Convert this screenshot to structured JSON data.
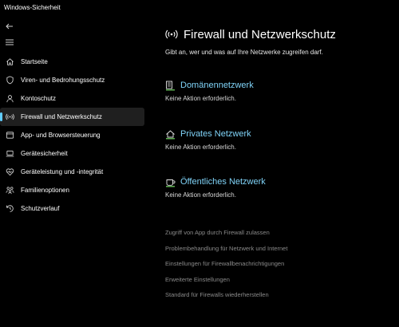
{
  "window": {
    "title": "Windows-Sicherheit"
  },
  "sidebar": {
    "items": [
      {
        "label": "Startseite",
        "icon": "home-icon"
      },
      {
        "label": "Viren- und Bedrohungsschutz",
        "icon": "shield-icon"
      },
      {
        "label": "Kontoschutz",
        "icon": "person-icon"
      },
      {
        "label": "Firewall und Netzwerkschutz",
        "icon": "antenna-icon",
        "active": true
      },
      {
        "label": "App- und Browsersteuerung",
        "icon": "app-window-icon"
      },
      {
        "label": "Gerätesicherheit",
        "icon": "laptop-icon"
      },
      {
        "label": "Geräteleistung und -integrität",
        "icon": "heart-pulse-icon"
      },
      {
        "label": "Familienoptionen",
        "icon": "family-icon"
      },
      {
        "label": "Schutzverlauf",
        "icon": "history-icon"
      }
    ]
  },
  "main": {
    "title": "Firewall und Netzwerkschutz",
    "subtitle": "Gibt an, wer und was auf Ihre Netzwerke zugreifen darf.",
    "networks": [
      {
        "title": "Domänennetzwerk",
        "status": "Keine Aktion erforderlich.",
        "icon": "domain-network-icon"
      },
      {
        "title": "Privates Netzwerk",
        "status": "Keine Aktion erforderlich.",
        "icon": "private-network-icon"
      },
      {
        "title": "Öffentliches Netzwerk",
        "status": "Keine Aktion erforderlich.",
        "icon": "public-network-icon"
      }
    ],
    "links": [
      "Zugriff von App durch Firewall zulassen",
      "Problembehandlung für Netzwerk und Internet",
      "Einstellungen für Firewallbenachrichtigungen",
      "Erweiterte Einstellungen",
      "Standard für Firewalls wiederherstellen"
    ]
  },
  "colors": {
    "background": "#000000",
    "accent": "#60cdff",
    "network_title": "#80d4f9",
    "status_ok": "#6ccb5f",
    "link_muted": "#8a8a8a"
  }
}
